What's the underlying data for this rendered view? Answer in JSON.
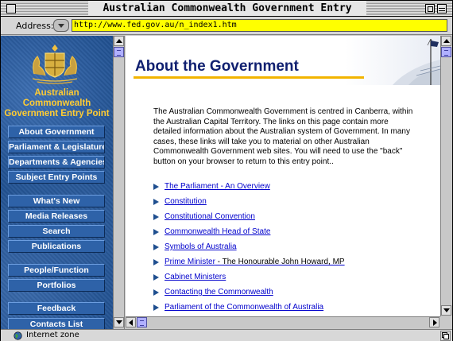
{
  "window": {
    "title": "Australian Commonwealth Government Entry Point"
  },
  "address": {
    "label": "Address:",
    "url": "http://www.fed.gov.au/n_index1.htm"
  },
  "sidebar": {
    "title_line1": "Australian Commonwealth",
    "title_line2": "Government Entry Point",
    "nav": [
      "About Government",
      "Parliament & Legislature",
      "Departments & Agencies",
      "Subject Entry Points",
      "What's New",
      "Media Releases",
      "Search",
      "Publications",
      "People/Function",
      "Portfolios",
      "Feedback",
      "Contacts List"
    ]
  },
  "main": {
    "heading": "About the Government",
    "intro": "The Australian Commonwealth Government is centred in Canberra, within the Australian Capital Territory. The links on this page contain more detailed information about the Australian system of Government. In many cases, these links will take you to material on other Australian Commonwealth Government web sites. You will need to use the \"back\" button on your browser to return to this entry point..",
    "links": [
      {
        "label": "The Parliament - An Overview",
        "suffix": ""
      },
      {
        "label": "Constitution",
        "suffix": ""
      },
      {
        "label": "Constitutional Convention",
        "suffix": ""
      },
      {
        "label": "Commonwealth Head of State",
        "suffix": ""
      },
      {
        "label": "Symbols of Australia",
        "suffix": ""
      },
      {
        "label": "Prime Minister",
        "suffix": " - The Honourable John Howard, MP"
      },
      {
        "label": "Cabinet Ministers",
        "suffix": ""
      },
      {
        "label": "Contacting the Commonwealth",
        "suffix": ""
      },
      {
        "label": "Parliament of the Commonwealth of Australia",
        "suffix": ""
      }
    ]
  },
  "status": {
    "text": "Internet zone"
  },
  "colors": {
    "address_bg": "#ffff00",
    "heading": "#102070",
    "rule": "#f2b400",
    "sidebar_bg": "#1f4f8f",
    "sidebar_title": "#ffcc33",
    "link": "#0000cc"
  }
}
